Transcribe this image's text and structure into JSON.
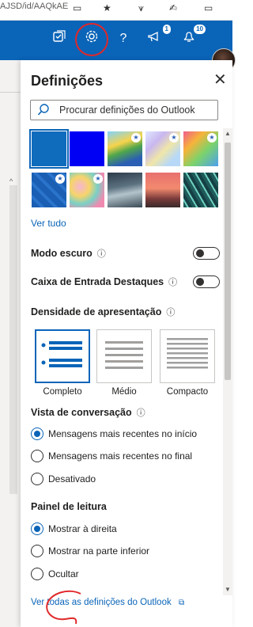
{
  "browser": {
    "url_fragment": "AJSD/id/AAQkAE",
    "icons": [
      "reader-mode-icon",
      "favorite-icon",
      "collections-icon",
      "reading-list-icon",
      "tab-actions-icon"
    ]
  },
  "outlook_bar": {
    "badges": {
      "megaphone": "1",
      "feedback": "10"
    },
    "colors": {
      "bar": "#0a64b8",
      "annotation": "#e0282a"
    }
  },
  "settings": {
    "title": "Definições",
    "search_placeholder": "Procurar definições do Outlook",
    "see_all": "Ver tudo",
    "dark_mode": "Modo escuro",
    "focused_inbox": "Caixa de Entrada Destaques",
    "display_density": "Densidade de apresentação",
    "density_options": [
      "Completo",
      "Médio",
      "Compacto"
    ],
    "conversation_view": "Vista de conversação",
    "conversation_options": [
      "Mensagens mais recentes no início",
      "Mensagens mais recentes no final",
      "Desativado"
    ],
    "reading_pane": "Painel de leitura",
    "reading_options": [
      "Mostrar à direita",
      "Mostrar na parte inferior",
      "Ocultar"
    ],
    "all_settings_link": "Ver todas as definições do Outlook"
  }
}
